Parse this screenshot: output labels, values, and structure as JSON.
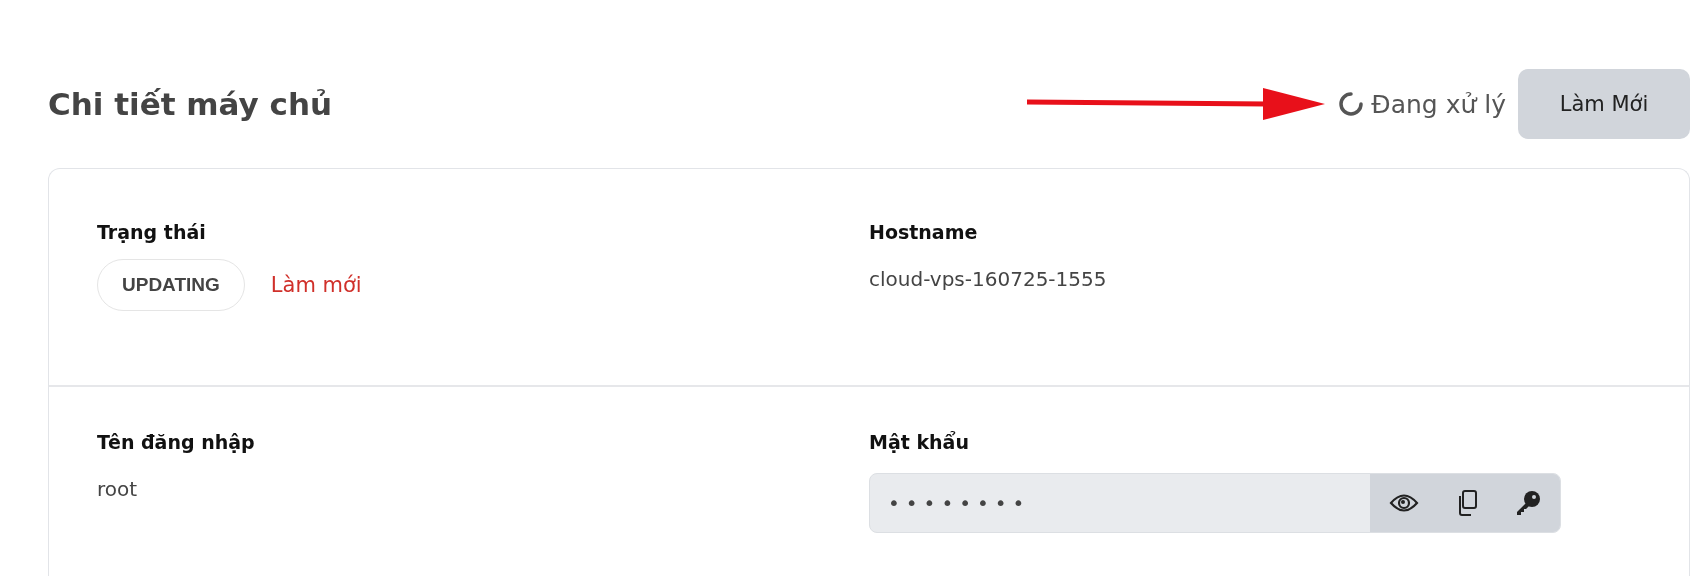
{
  "header": {
    "title": "Chi tiết máy chủ",
    "processing": {
      "text": "Đang xử lý",
      "loading": true
    },
    "refresh_button": "Làm Mới"
  },
  "fields": [
    {
      "kind": "status",
      "label": "Trạng thái",
      "badge": "UPDATING",
      "link": "Làm mới"
    },
    {
      "kind": "text",
      "label": "Hostname",
      "value": "cloud-vps-160725-1555"
    },
    {
      "kind": "text",
      "label": "Tên đăng nhập",
      "value": "root"
    },
    {
      "kind": "password",
      "label": "Mật khẩu",
      "value": "••••••••"
    }
  ]
}
